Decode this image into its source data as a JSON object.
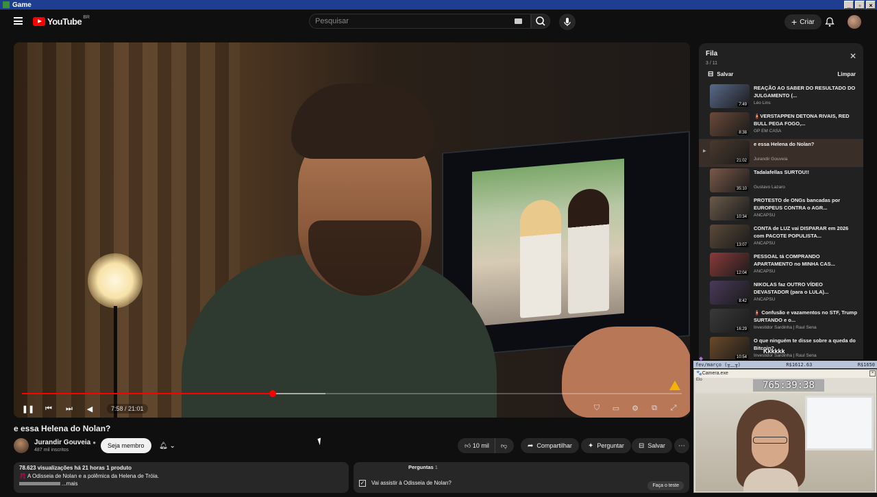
{
  "window": {
    "title": "Game"
  },
  "header": {
    "logo_text": "YouTube",
    "country": "BR",
    "search_placeholder": "Pesquisar",
    "create_label": "Criar"
  },
  "player": {
    "time": "7:58 / 21:01",
    "progress_fraction": 0.38,
    "buffer_fraction": 0.46
  },
  "video": {
    "title": "e essa Helena do Nolan?",
    "channel": "Jurandir Gouveia",
    "subscribers": "487 mil inscritos",
    "member_label": "Seja membro",
    "likes": "10 mil",
    "share_label": "Compartilhar",
    "ask_label": "Perguntar",
    "save_label": "Salvar"
  },
  "description": {
    "stats": "78.623 visualizações  há 21 horas  1 produto",
    "line": "A Odisseia de Nolan e a polêmica da Helena de Tróia.",
    "more": "...mais"
  },
  "questions": {
    "title": "Perguntas",
    "count": "1",
    "item": "Vai assistir à Odisseia de Nolan?",
    "button": "Faça o teste"
  },
  "queue": {
    "title": "Fila",
    "position": "3 / 11",
    "save_label": "Salvar",
    "clear_label": "Limpar",
    "items": [
      {
        "title": "REAÇÃO AO SABER DO RESULTADO DO JULGAMENTO (...",
        "channel": "Léo Lins",
        "duration": "7:49",
        "thumb": "#5a6a8a"
      },
      {
        "title": "🧯VERSTAPPEN DETONA RIVAIS, RED BULL PEGA FOGO,...",
        "channel": "GP EM CASA",
        "duration": "8:38",
        "thumb": "#6a4a3a"
      },
      {
        "title": "e essa Helena do Nolan?",
        "channel": "Jurandir Gouveia",
        "duration": "21:02",
        "thumb": "#4a3a2e"
      },
      {
        "title": "Tadalafellas SURTOU!!",
        "channel": "Gustavo Lazaro",
        "duration": "35:10",
        "thumb": "#7a5a4a"
      },
      {
        "title": "PROTESTO de ONGs bancadas por EUROPEUS CONTRA o AGR...",
        "channel": "ANCAPSU",
        "duration": "10:34",
        "thumb": "#6a5a4a"
      },
      {
        "title": "CONTA de LUZ vai DISPARAR em 2026 com PACOTE POPULISTA...",
        "channel": "ANCAPSU",
        "duration": "13:07",
        "thumb": "#5a4a3a"
      },
      {
        "title": "PESSOAL tá COMPRANDO APARTAMENTO no MINHA CAS...",
        "channel": "ANCAPSU",
        "duration": "12:04",
        "thumb": "#8a3a3a"
      },
      {
        "title": "NIKOLAS faz OUTRO VÍDEO DEVASTADOR (para o LULA)...",
        "channel": "ANCAPSU",
        "duration": "8:42",
        "thumb": "#4a3a5a"
      },
      {
        "title": "🧯 Confusão e vazamentos no STF, Trump SURTANDO e o...",
        "channel": "Investidor Sardinha | Raul Sena",
        "duration": "16:29",
        "thumb": "#3a3a3a"
      },
      {
        "title": "O que ninguém te disse sobre a queda do Bitcoin?",
        "channel": "Investidor Sardinha | Raul Sena",
        "duration": "10:54",
        "thumb": "#6a4a2a"
      }
    ]
  },
  "overlay": {
    "left": "fev/março (╥﹏╥)",
    "mid": "R$1612.63",
    "right": "R$1650",
    "cam_title": "🐾Camera.exe",
    "cam_menu": "Elo",
    "timer": "765:39:38",
    "chat_text": "Kkkkkk"
  }
}
